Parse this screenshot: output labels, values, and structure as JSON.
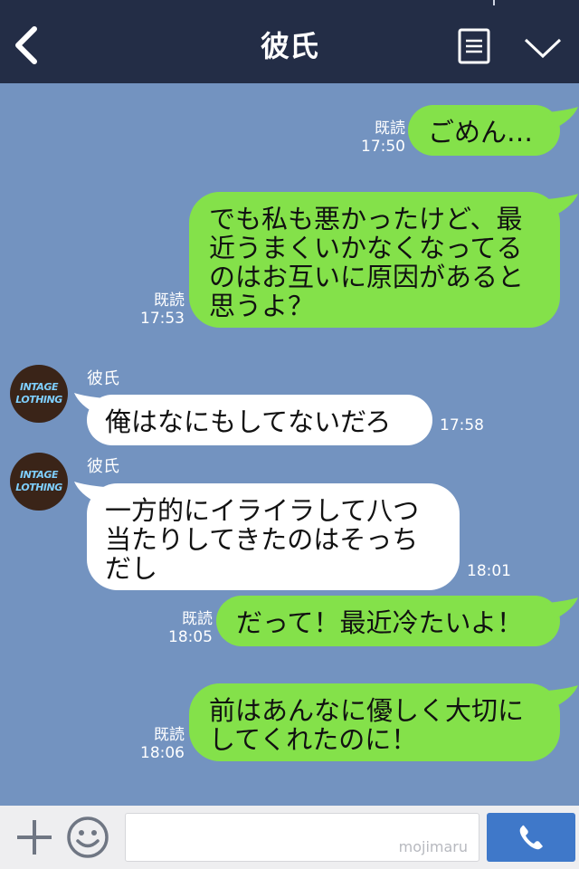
{
  "header": {
    "title": "彼氏"
  },
  "messages": [
    {
      "id": "m1",
      "side": "me",
      "text": "ごめん…",
      "read": "既読",
      "time": "17:50"
    },
    {
      "id": "m2",
      "side": "me",
      "text": "でも私も悪かったけど、最\n近うまくいかなくなってる\nのはお互いに原因があると\n思うよ？",
      "read": "既読",
      "time": "17:53"
    },
    {
      "id": "m3",
      "side": "them",
      "sender": "彼氏",
      "text": "俺はなにもしてないだろ",
      "time": "17:58"
    },
    {
      "id": "m4",
      "side": "them",
      "sender": "彼氏",
      "text": "一方的にイライラして八つ\n当たりしてきたのはそっち\nだし",
      "time": "18:01"
    },
    {
      "id": "m5",
      "side": "me",
      "text": "だって！最近冷たいよ！",
      "read": "既読",
      "time": "18:05"
    },
    {
      "id": "m6",
      "side": "me",
      "text": "前はあんなに優しく大切に\nしてくれたのに！",
      "read": "既読",
      "time": "18:06"
    }
  ],
  "avatar": {
    "line1": "INTAGE",
    "line2": "LOTHING"
  },
  "footer": {
    "watermark": "mojimaru"
  },
  "colors": {
    "header": "#232d46",
    "chat_bg": "#7393c0",
    "my_bubble": "#84e14a",
    "their_bubble": "#ffffff",
    "call": "#3f78c9"
  },
  "icons": [
    "back-arrow-icon",
    "menu-icon",
    "chevron-down-icon",
    "plus-icon",
    "emoji-icon",
    "phone-icon"
  ]
}
